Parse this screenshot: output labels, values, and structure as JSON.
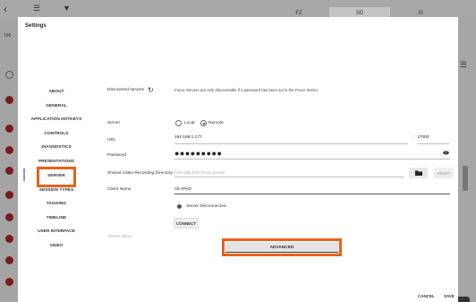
{
  "dialog": {
    "title": "Settings"
  },
  "nav": {
    "items": [
      {
        "label": "ABOUT"
      },
      {
        "label": "GENERAL"
      },
      {
        "label": "APPLICATION HOTKEYS"
      },
      {
        "label": "CONTROLS"
      },
      {
        "label": "DIAGNOSTICS"
      },
      {
        "label": "PRESENTATIONS"
      },
      {
        "label": "SERVER"
      },
      {
        "label": "SESSION TYPES"
      },
      {
        "label": "TAGGING"
      },
      {
        "label": "TIMELINE"
      },
      {
        "label": "USER INTERFACE"
      },
      {
        "label": "VIDEO"
      }
    ],
    "selected": "SERVER"
  },
  "server": {
    "discovered_label": "Discovered servers",
    "discovered_note": "Focus Servers are only discoverable if a password has been set in the Focus Server",
    "server_label": "Server",
    "option_local": "Local",
    "option_remote": "Remote",
    "selected_option": "Remote",
    "url_label": "URL",
    "url_value": "192.168.1.177",
    "port_sep": ":",
    "port_value": "17000",
    "password_label": "Password",
    "password_mask": "●●●●●●●●●",
    "shared_label": "Shared Video Recording Directory",
    "shared_placeholder": "(Use path from Focus Server)",
    "reset_label": "RESET",
    "client_label": "Client Name",
    "client_value": "OL-IPAD",
    "status_text": "Server Disconnected",
    "connect_label": "CONNECT",
    "server_name_label": "Server Name",
    "advanced_label": "ADVANCED"
  },
  "footer": {
    "cancel_label": "CANCEL",
    "save_label": "SAVE"
  },
  "background": {
    "seg_1": "FZ",
    "seg_2": "SD",
    "seg_3": "SI",
    "left_number": "190"
  },
  "colors": {
    "highlight": "#e8611c",
    "active_bar": "#9c8fd1"
  }
}
